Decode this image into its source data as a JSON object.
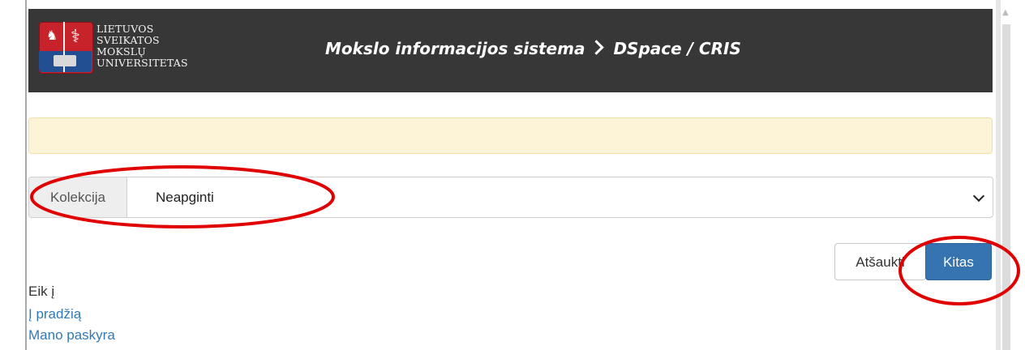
{
  "header": {
    "university_lines": [
      "LIETUVOS",
      "SVEIKATOS",
      "MOKSLŲ",
      "UNIVERSITETAS"
    ],
    "title_part1": "Mokslo informacijos sistema",
    "title_part2": "DSpace / CRIS"
  },
  "form": {
    "collection_label": "Kolekcija",
    "collection_value": "Neapginti"
  },
  "actions": {
    "cancel_label": "Atšaukti",
    "next_label": "Kitas"
  },
  "nav": {
    "heading": "Eik į",
    "links": [
      "Į pradžią",
      "Mano paskyra"
    ]
  },
  "annotations": {
    "color": "#e00000",
    "shape": "ellipse"
  }
}
